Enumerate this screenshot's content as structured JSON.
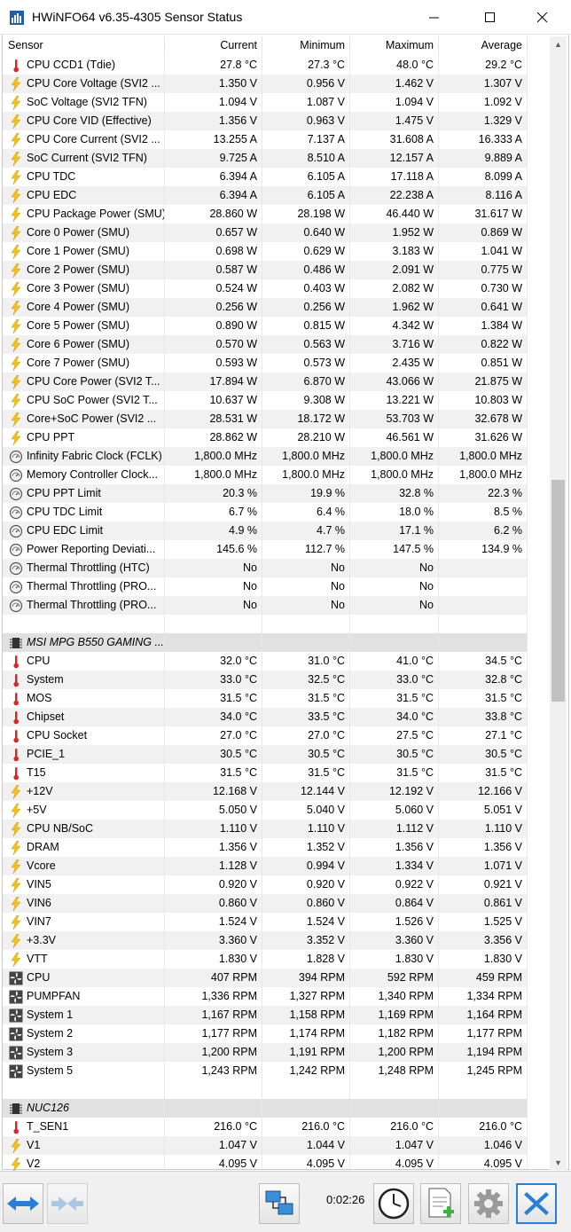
{
  "window": {
    "title": "HWiNFO64 v6.35-4305 Sensor Status"
  },
  "columns": {
    "sensor": "Sensor",
    "current": "Current",
    "minimum": "Minimum",
    "maximum": "Maximum",
    "average": "Average"
  },
  "rows": [
    {
      "type": "sensor",
      "icon": "temperature",
      "name": "CPU CCD1 (Tdie)",
      "cur": "27.8 °C",
      "min": "27.3 °C",
      "max": "48.0 °C",
      "avg": "29.2 °C"
    },
    {
      "type": "sensor",
      "icon": "voltage",
      "name": "CPU Core Voltage (SVI2 ...",
      "cur": "1.350 V",
      "min": "0.956 V",
      "max": "1.462 V",
      "avg": "1.307 V"
    },
    {
      "type": "sensor",
      "icon": "voltage",
      "name": "SoC Voltage (SVI2 TFN)",
      "cur": "1.094 V",
      "min": "1.087 V",
      "max": "1.094 V",
      "avg": "1.092 V"
    },
    {
      "type": "sensor",
      "icon": "voltage",
      "name": "CPU Core VID (Effective)",
      "cur": "1.356 V",
      "min": "0.963 V",
      "max": "1.475 V",
      "avg": "1.329 V"
    },
    {
      "type": "sensor",
      "icon": "voltage",
      "name": "CPU Core Current (SVI2 ...",
      "cur": "13.255 A",
      "min": "7.137 A",
      "max": "31.608 A",
      "avg": "16.333 A"
    },
    {
      "type": "sensor",
      "icon": "voltage",
      "name": "SoC Current (SVI2 TFN)",
      "cur": "9.725 A",
      "min": "8.510 A",
      "max": "12.157 A",
      "avg": "9.889 A"
    },
    {
      "type": "sensor",
      "icon": "voltage",
      "name": "CPU TDC",
      "cur": "6.394 A",
      "min": "6.105 A",
      "max": "17.118 A",
      "avg": "8.099 A"
    },
    {
      "type": "sensor",
      "icon": "voltage",
      "name": "CPU EDC",
      "cur": "6.394 A",
      "min": "6.105 A",
      "max": "22.238 A",
      "avg": "8.116 A"
    },
    {
      "type": "sensor",
      "icon": "voltage",
      "name": "CPU Package Power (SMU)",
      "cur": "28.860 W",
      "min": "28.198 W",
      "max": "46.440 W",
      "avg": "31.617 W"
    },
    {
      "type": "sensor",
      "icon": "voltage",
      "name": "Core 0 Power (SMU)",
      "cur": "0.657 W",
      "min": "0.640 W",
      "max": "1.952 W",
      "avg": "0.869 W"
    },
    {
      "type": "sensor",
      "icon": "voltage",
      "name": "Core 1 Power (SMU)",
      "cur": "0.698 W",
      "min": "0.629 W",
      "max": "3.183 W",
      "avg": "1.041 W"
    },
    {
      "type": "sensor",
      "icon": "voltage",
      "name": "Core 2 Power (SMU)",
      "cur": "0.587 W",
      "min": "0.486 W",
      "max": "2.091 W",
      "avg": "0.775 W"
    },
    {
      "type": "sensor",
      "icon": "voltage",
      "name": "Core 3 Power (SMU)",
      "cur": "0.524 W",
      "min": "0.403 W",
      "max": "2.082 W",
      "avg": "0.730 W"
    },
    {
      "type": "sensor",
      "icon": "voltage",
      "name": "Core 4 Power (SMU)",
      "cur": "0.256 W",
      "min": "0.256 W",
      "max": "1.962 W",
      "avg": "0.641 W"
    },
    {
      "type": "sensor",
      "icon": "voltage",
      "name": "Core 5 Power (SMU)",
      "cur": "0.890 W",
      "min": "0.815 W",
      "max": "4.342 W",
      "avg": "1.384 W"
    },
    {
      "type": "sensor",
      "icon": "voltage",
      "name": "Core 6 Power (SMU)",
      "cur": "0.570 W",
      "min": "0.563 W",
      "max": "3.716 W",
      "avg": "0.822 W"
    },
    {
      "type": "sensor",
      "icon": "voltage",
      "name": "Core 7 Power (SMU)",
      "cur": "0.593 W",
      "min": "0.573 W",
      "max": "2.435 W",
      "avg": "0.851 W"
    },
    {
      "type": "sensor",
      "icon": "voltage",
      "name": "CPU Core Power (SVI2 T...",
      "cur": "17.894 W",
      "min": "6.870 W",
      "max": "43.066 W",
      "avg": "21.875 W"
    },
    {
      "type": "sensor",
      "icon": "voltage",
      "name": "CPU SoC Power (SVI2 T...",
      "cur": "10.637 W",
      "min": "9.308 W",
      "max": "13.221 W",
      "avg": "10.803 W"
    },
    {
      "type": "sensor",
      "icon": "voltage",
      "name": "Core+SoC Power (SVI2 ...",
      "cur": "28.531 W",
      "min": "18.172 W",
      "max": "53.703 W",
      "avg": "32.678 W"
    },
    {
      "type": "sensor",
      "icon": "voltage",
      "name": "CPU PPT",
      "cur": "28.862 W",
      "min": "28.210 W",
      "max": "46.561 W",
      "avg": "31.626 W"
    },
    {
      "type": "sensor",
      "icon": "clock",
      "name": "Infinity Fabric Clock (FCLK)",
      "cur": "1,800.0 MHz",
      "min": "1,800.0 MHz",
      "max": "1,800.0 MHz",
      "avg": "1,800.0 MHz"
    },
    {
      "type": "sensor",
      "icon": "clock",
      "name": "Memory Controller Clock...",
      "cur": "1,800.0 MHz",
      "min": "1,800.0 MHz",
      "max": "1,800.0 MHz",
      "avg": "1,800.0 MHz"
    },
    {
      "type": "sensor",
      "icon": "clock",
      "name": "CPU PPT Limit",
      "cur": "20.3 %",
      "min": "19.9 %",
      "max": "32.8 %",
      "avg": "22.3 %"
    },
    {
      "type": "sensor",
      "icon": "clock",
      "name": "CPU TDC Limit",
      "cur": "6.7 %",
      "min": "6.4 %",
      "max": "18.0 %",
      "avg": "8.5 %"
    },
    {
      "type": "sensor",
      "icon": "clock",
      "name": "CPU EDC Limit",
      "cur": "4.9 %",
      "min": "4.7 %",
      "max": "17.1 %",
      "avg": "6.2 %"
    },
    {
      "type": "sensor",
      "icon": "clock",
      "name": "Power Reporting Deviati...",
      "cur": "145.6 %",
      "min": "112.7 %",
      "max": "147.5 %",
      "avg": "134.9 %"
    },
    {
      "type": "sensor",
      "icon": "clock",
      "name": "Thermal Throttling (HTC)",
      "cur": "No",
      "min": "No",
      "max": "No",
      "avg": ""
    },
    {
      "type": "sensor",
      "icon": "clock",
      "name": "Thermal Throttling (PRO...",
      "cur": "No",
      "min": "No",
      "max": "No",
      "avg": ""
    },
    {
      "type": "sensor",
      "icon": "clock",
      "name": "Thermal Throttling (PRO...",
      "cur": "No",
      "min": "No",
      "max": "No",
      "avg": ""
    },
    {
      "type": "blank"
    },
    {
      "type": "group",
      "icon": "chip",
      "name": "MSI MPG B550 GAMING ..."
    },
    {
      "type": "sensor",
      "icon": "temperature",
      "name": "CPU",
      "cur": "32.0 °C",
      "min": "31.0 °C",
      "max": "41.0 °C",
      "avg": "34.5 °C"
    },
    {
      "type": "sensor",
      "icon": "temperature",
      "name": "System",
      "cur": "33.0 °C",
      "min": "32.5 °C",
      "max": "33.0 °C",
      "avg": "32.8 °C"
    },
    {
      "type": "sensor",
      "icon": "temperature",
      "name": "MOS",
      "cur": "31.5 °C",
      "min": "31.5 °C",
      "max": "31.5 °C",
      "avg": "31.5 °C"
    },
    {
      "type": "sensor",
      "icon": "temperature",
      "name": "Chipset",
      "cur": "34.0 °C",
      "min": "33.5 °C",
      "max": "34.0 °C",
      "avg": "33.8 °C"
    },
    {
      "type": "sensor",
      "icon": "temperature",
      "name": "CPU Socket",
      "cur": "27.0 °C",
      "min": "27.0 °C",
      "max": "27.5 °C",
      "avg": "27.1 °C"
    },
    {
      "type": "sensor",
      "icon": "temperature",
      "name": "PCIE_1",
      "cur": "30.5 °C",
      "min": "30.5 °C",
      "max": "30.5 °C",
      "avg": "30.5 °C"
    },
    {
      "type": "sensor",
      "icon": "temperature",
      "name": "T15",
      "cur": "31.5 °C",
      "min": "31.5 °C",
      "max": "31.5 °C",
      "avg": "31.5 °C"
    },
    {
      "type": "sensor",
      "icon": "voltage",
      "name": "+12V",
      "cur": "12.168 V",
      "min": "12.144 V",
      "max": "12.192 V",
      "avg": "12.166 V"
    },
    {
      "type": "sensor",
      "icon": "voltage",
      "name": "+5V",
      "cur": "5.050 V",
      "min": "5.040 V",
      "max": "5.060 V",
      "avg": "5.051 V"
    },
    {
      "type": "sensor",
      "icon": "voltage",
      "name": "CPU NB/SoC",
      "cur": "1.110 V",
      "min": "1.110 V",
      "max": "1.112 V",
      "avg": "1.110 V"
    },
    {
      "type": "sensor",
      "icon": "voltage",
      "name": "DRAM",
      "cur": "1.356 V",
      "min": "1.352 V",
      "max": "1.356 V",
      "avg": "1.356 V"
    },
    {
      "type": "sensor",
      "icon": "voltage",
      "name": "Vcore",
      "cur": "1.128 V",
      "min": "0.994 V",
      "max": "1.334 V",
      "avg": "1.071 V"
    },
    {
      "type": "sensor",
      "icon": "voltage",
      "name": "VIN5",
      "cur": "0.920 V",
      "min": "0.920 V",
      "max": "0.922 V",
      "avg": "0.921 V"
    },
    {
      "type": "sensor",
      "icon": "voltage",
      "name": "VIN6",
      "cur": "0.860 V",
      "min": "0.860 V",
      "max": "0.864 V",
      "avg": "0.861 V"
    },
    {
      "type": "sensor",
      "icon": "voltage",
      "name": "VIN7",
      "cur": "1.524 V",
      "min": "1.524 V",
      "max": "1.526 V",
      "avg": "1.525 V"
    },
    {
      "type": "sensor",
      "icon": "voltage",
      "name": "+3.3V",
      "cur": "3.360 V",
      "min": "3.352 V",
      "max": "3.360 V",
      "avg": "3.356 V"
    },
    {
      "type": "sensor",
      "icon": "voltage",
      "name": "VTT",
      "cur": "1.830 V",
      "min": "1.828 V",
      "max": "1.830 V",
      "avg": "1.830 V"
    },
    {
      "type": "sensor",
      "icon": "fan",
      "name": "CPU",
      "cur": "407 RPM",
      "min": "394 RPM",
      "max": "592 RPM",
      "avg": "459 RPM"
    },
    {
      "type": "sensor",
      "icon": "fan",
      "name": "PUMPFAN",
      "cur": "1,336 RPM",
      "min": "1,327 RPM",
      "max": "1,340 RPM",
      "avg": "1,334 RPM"
    },
    {
      "type": "sensor",
      "icon": "fan",
      "name": "System 1",
      "cur": "1,167 RPM",
      "min": "1,158 RPM",
      "max": "1,169 RPM",
      "avg": "1,164 RPM"
    },
    {
      "type": "sensor",
      "icon": "fan",
      "name": "System 2",
      "cur": "1,177 RPM",
      "min": "1,174 RPM",
      "max": "1,182 RPM",
      "avg": "1,177 RPM"
    },
    {
      "type": "sensor",
      "icon": "fan",
      "name": "System 3",
      "cur": "1,200 RPM",
      "min": "1,191 RPM",
      "max": "1,200 RPM",
      "avg": "1,194 RPM"
    },
    {
      "type": "sensor",
      "icon": "fan",
      "name": "System 5",
      "cur": "1,243 RPM",
      "min": "1,242 RPM",
      "max": "1,248 RPM",
      "avg": "1,245 RPM"
    },
    {
      "type": "blank"
    },
    {
      "type": "group",
      "icon": "chip",
      "name": "NUC126"
    },
    {
      "type": "sensor",
      "icon": "temperature",
      "name": "T_SEN1",
      "cur": "216.0 °C",
      "min": "216.0 °C",
      "max": "216.0 °C",
      "avg": "216.0 °C"
    },
    {
      "type": "sensor",
      "icon": "voltage",
      "name": "V1",
      "cur": "1.047 V",
      "min": "1.044 V",
      "max": "1.047 V",
      "avg": "1.046 V"
    },
    {
      "type": "sensor",
      "icon": "voltage",
      "name": "V2",
      "cur": "4.095 V",
      "min": "4.095 V",
      "max": "4.095 V",
      "avg": "4.095 V"
    }
  ],
  "toolbar": {
    "timer": "0:02:26"
  },
  "colors": {
    "accent_blue": "#2a7fd4",
    "flame_yellow": "#f3c21a",
    "thermo_red": "#d22a2a",
    "group_bg": "#e1e1e1",
    "alt_row": "#f1f1f1"
  }
}
